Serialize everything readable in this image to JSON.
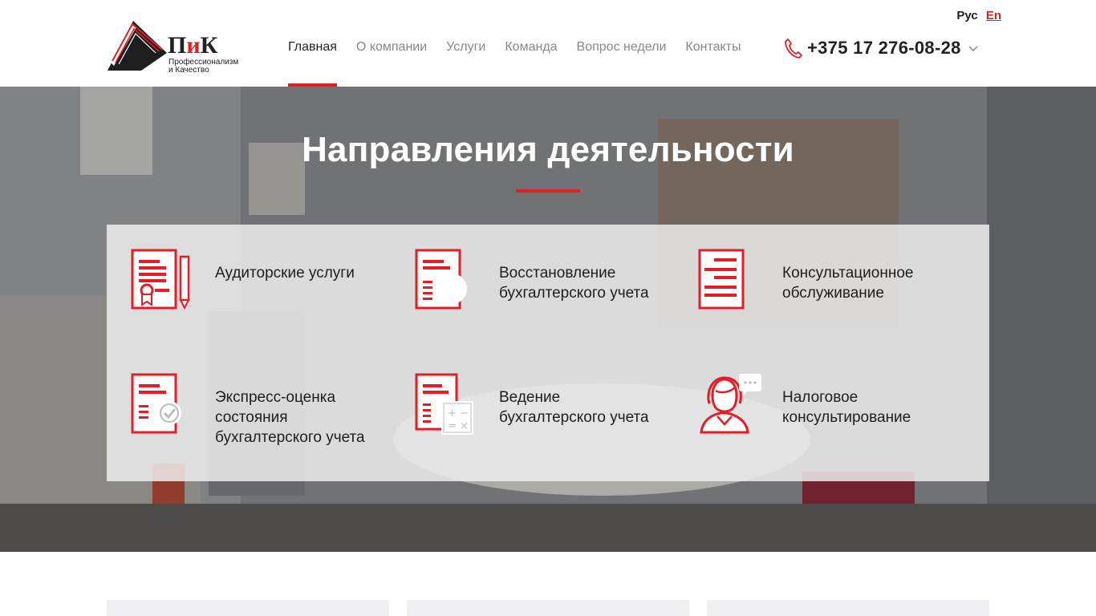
{
  "brand": {
    "name_part1": "П",
    "name_part2": "и",
    "name_part3": "К",
    "subtitle_line1": "Профессионализм",
    "subtitle_line2": "и Качество"
  },
  "nav": {
    "items": [
      {
        "label": "Главная",
        "active": true
      },
      {
        "label": "О компании",
        "active": false
      },
      {
        "label": "Услуги",
        "active": false
      },
      {
        "label": "Команда",
        "active": false
      },
      {
        "label": "Вопрос недели",
        "active": false
      },
      {
        "label": "Контакты",
        "active": false
      }
    ]
  },
  "lang": {
    "ru": "Рус",
    "en": "En"
  },
  "phone": {
    "number": "+375 17 276-08-28"
  },
  "hero": {
    "title": "Направления деятельности"
  },
  "services": [
    {
      "label_line1": "Аудиторские услуги",
      "label_line2": "",
      "label_line3": "",
      "icon": "audit-document-icon"
    },
    {
      "label_line1": "Восстановление",
      "label_line2": "бухгалтерского учета",
      "label_line3": "",
      "icon": "restore-document-icon"
    },
    {
      "label_line1": "Консультационное",
      "label_line2": "обслуживание",
      "label_line3": "",
      "icon": "checklist-document-icon"
    },
    {
      "label_line1": "Экспресс-оценка",
      "label_line2": "состояния",
      "label_line3": "бухгалтерского учета",
      "icon": "check-document-icon"
    },
    {
      "label_line1": "Ведение",
      "label_line2": "бухгалтерского учета",
      "label_line3": "",
      "icon": "calculator-document-icon"
    },
    {
      "label_line1": "Налоговое",
      "label_line2": "консультирование",
      "label_line3": "",
      "icon": "consultant-chat-icon"
    }
  ],
  "colors": {
    "accent": "#e31e24",
    "text": "#222222"
  }
}
